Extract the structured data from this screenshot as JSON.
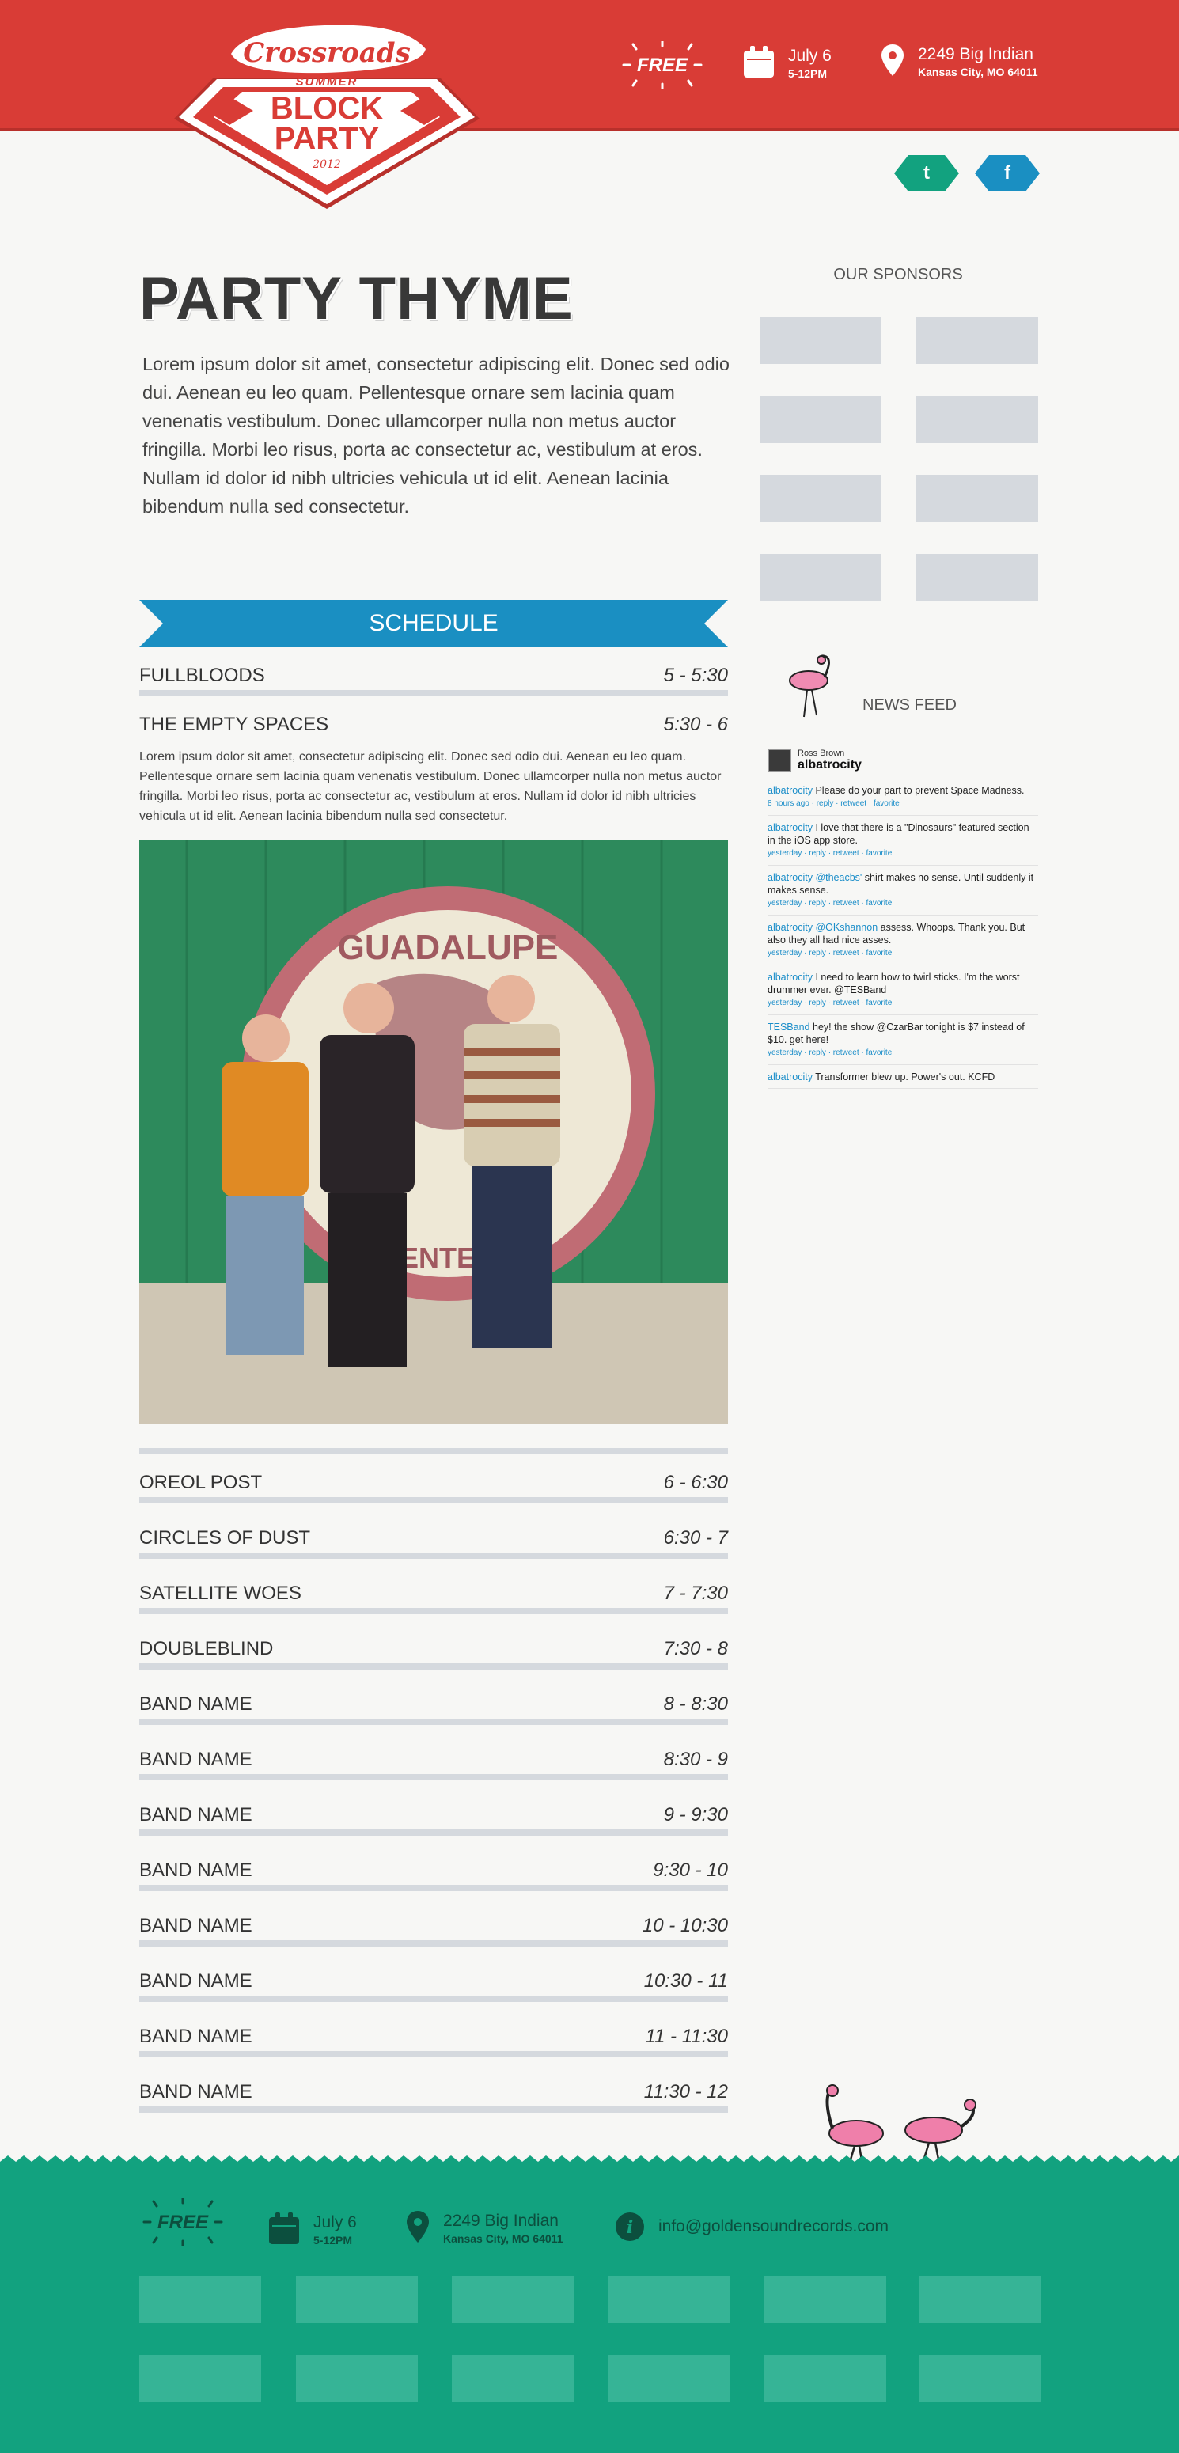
{
  "header": {
    "logo_script": "Crossroads",
    "logo_summer": "SUMMER",
    "logo_line1": "BLOCK",
    "logo_line2": "PARTY",
    "logo_year": "2012",
    "free_label": "FREE",
    "date_main": "July 6",
    "date_sub": "5-12PM",
    "address_main": "2249 Big Indian",
    "address_sub": "Kansas City, MO 64011",
    "colors": {
      "red": "#d93c36",
      "teal": "#12a27f",
      "blue": "#1a8fc2"
    }
  },
  "social": {
    "twitter_glyph": "t",
    "facebook_glyph": "f",
    "twitter_icon": "twitter-icon",
    "facebook_icon": "facebook-icon"
  },
  "intro": {
    "title": "PARTY THYME",
    "body": "Lorem ipsum dolor sit amet, consectetur adipiscing elit. Donec sed odio dui. Aenean eu leo quam. Pellentesque ornare sem lacinia quam venenatis vestibulum. Donec ullamcorper nulla non metus auctor fringilla. Morbi leo risus, porta ac consectetur ac, vestibulum at eros. Nullam id dolor id nibh ultricies vehicula ut id elit. Aenean lacinia bibendum nulla sed consectetur."
  },
  "schedule": {
    "title": "SCHEDULE",
    "first": {
      "name": "FULLBLOODS",
      "time": "5 - 5:30"
    },
    "featured": {
      "name": "THE EMPTY SPACES",
      "time": "5:30 - 6",
      "description": "Lorem ipsum dolor sit amet, consectetur adipiscing elit. Donec sed odio dui. Aenean eu leo quam. Pellentesque ornare sem lacinia quam venenatis vestibulum. Donec ullamcorper nulla non metus auctor fringilla. Morbi leo risus, porta ac consectetur ac, vestibulum at eros. Nullam id dolor id nibh ultricies vehicula ut id elit. Aenean lacinia bibendum nulla sed consectetur.",
      "photo_sign": "GUADALUPE",
      "photo_sign_bottom": "ENTER"
    },
    "items": [
      {
        "name": "OREOL POST",
        "time": "6 - 6:30"
      },
      {
        "name": "CIRCLES OF DUST",
        "time": "6:30 - 7"
      },
      {
        "name": "SATELLITE WOES",
        "time": "7 - 7:30"
      },
      {
        "name": "DOUBLEBLIND",
        "time": "7:30 - 8"
      },
      {
        "name": "BAND NAME",
        "time": "8 - 8:30"
      },
      {
        "name": "BAND NAME",
        "time": "8:30 - 9"
      },
      {
        "name": "BAND NAME",
        "time": "9 - 9:30"
      },
      {
        "name": "BAND NAME",
        "time": "9:30 - 10"
      },
      {
        "name": "BAND NAME",
        "time": "10 - 10:30"
      },
      {
        "name": "BAND NAME",
        "time": "10:30 - 11"
      },
      {
        "name": "BAND NAME",
        "time": "11 - 11:30"
      },
      {
        "name": "BAND NAME",
        "time": "11:30 - 12"
      }
    ]
  },
  "sponsors": {
    "title": "OUR SPONSORS",
    "count": 8
  },
  "news": {
    "title": "NEWS FEED",
    "user_name": "Ross Brown",
    "user_handle": "albatrocity",
    "tweets": [
      {
        "user": "albatrocity",
        "text": " Please do your part to prevent Space Madness.",
        "meta": "8 hours ago · reply · retweet · favorite"
      },
      {
        "user": "albatrocity",
        "text": " I love that there is a \"Dinosaurs\" featured section in the iOS app store.",
        "meta": "yesterday · reply · retweet · favorite"
      },
      {
        "user": "albatrocity @theacbs'",
        "text": " shirt makes no sense. Until suddenly it makes sense.",
        "meta": "yesterday · reply · retweet · favorite"
      },
      {
        "user": "albatrocity @OKshannon",
        "text": " assess. Whoops. Thank you. But also they all had nice asses.",
        "meta": "yesterday · reply · retweet · favorite"
      },
      {
        "user": "albatrocity",
        "text": " I need to learn how to twirl sticks. I'm the worst drummer ever. @TESBand",
        "meta": "yesterday · reply · retweet · favorite"
      },
      {
        "user": "TESBand",
        "text": " hey! the show @CzarBar tonight is $7 instead of $10. get here!",
        "meta": "yesterday · reply · retweet · favorite"
      },
      {
        "user": "albatrocity",
        "text": " Transformer blew up. Power's out. KCFD",
        "meta": ""
      }
    ]
  },
  "footer": {
    "free_label": "FREE",
    "date_main": "July 6",
    "date_sub": "5-12PM",
    "address_main": "2249 Big Indian",
    "address_sub": "Kansas City, MO 64011",
    "email": "info@goldensoundrecords.com",
    "info_glyph": "i",
    "box_count": 12
  }
}
